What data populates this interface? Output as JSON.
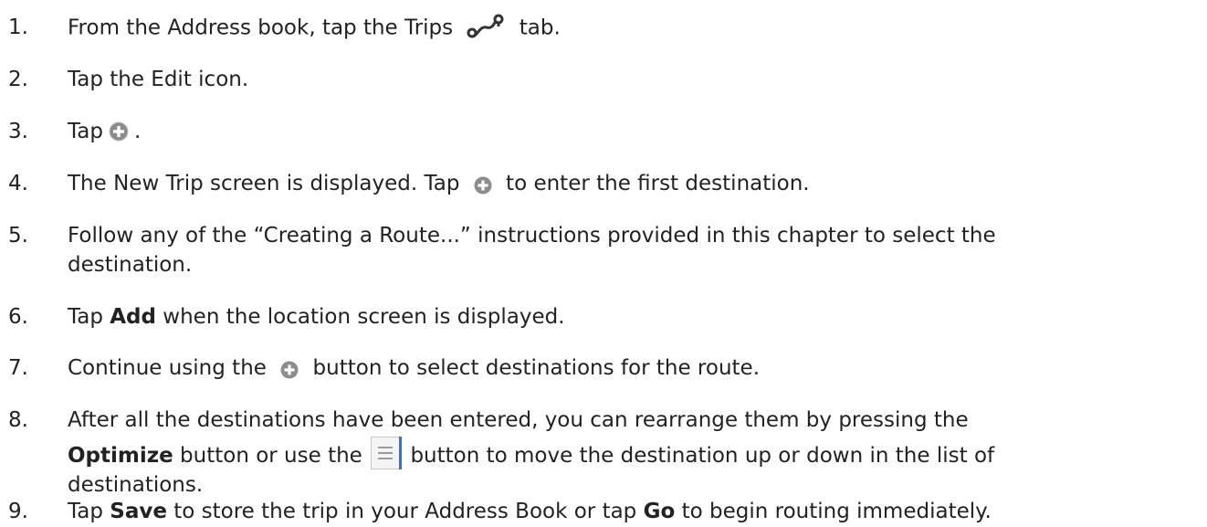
{
  "steps": [
    {
      "num": "1.",
      "pre": "From the Address book, tap the Trips",
      "post": "tab."
    },
    {
      "num": "2.",
      "text": "Tap the Edit icon."
    },
    {
      "num": "3.",
      "pre": "Tap",
      "post": "."
    },
    {
      "num": "4.",
      "pre": "The New Trip screen is displayed. Tap",
      "post": "to enter the first destination."
    },
    {
      "num": "5.",
      "line1": "Follow any of the “Creating a Route...” instructions provided in this chapter to select the",
      "line2": "destination."
    },
    {
      "num": "6.",
      "pre": "Tap",
      "bold": "Add",
      "post": "when the location screen is displayed."
    },
    {
      "num": "7.",
      "pre": "Continue using the",
      "post": "button to select destinations for the route."
    },
    {
      "num": "8.",
      "line1": "After all the destinations have been entered, you can rearrange them by pressing the",
      "bold": "Optimize",
      "mid": "button or use the",
      "post": "button to move the destination up or down in the list of",
      "line3": "destinations."
    },
    {
      "num": "9.",
      "pre": "Tap",
      "bold1": "Save",
      "mid": "to store the trip in your Address Book or tap",
      "bold2": "Go",
      "post": "to begin routing immediately."
    }
  ],
  "icons": {
    "trips": "trips-route-icon",
    "add": "plus-circle-icon",
    "reorder": "list-reorder-icon"
  },
  "colors": {
    "text": "#222222",
    "icon_gray": "#9a9a9a",
    "reorder_accent": "#3d6fb5"
  }
}
